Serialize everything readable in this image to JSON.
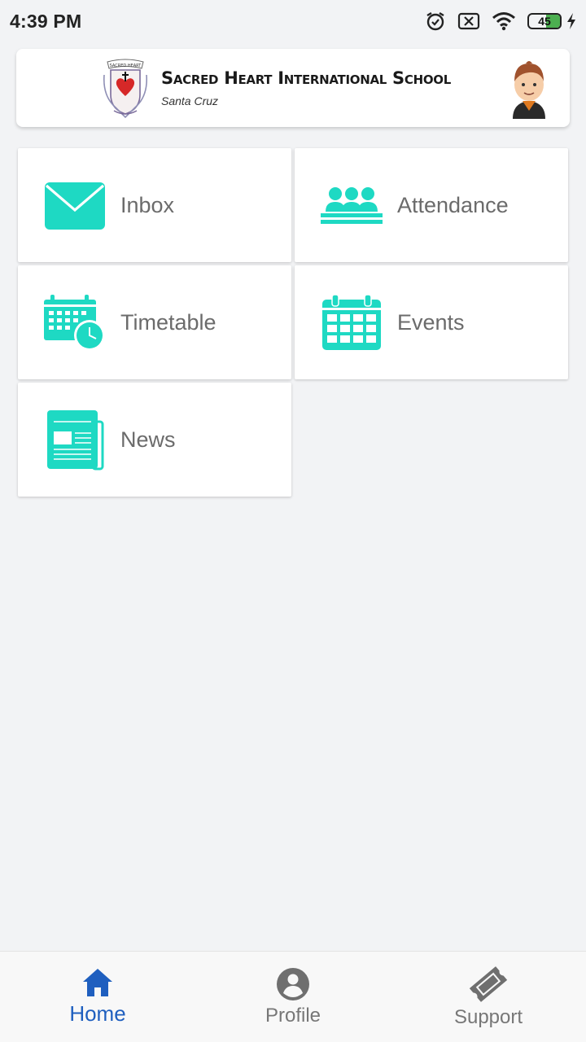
{
  "status_bar": {
    "time": "4:39 PM",
    "battery": "45"
  },
  "header": {
    "school_name": "Sacred Heart International School",
    "location": "Santa Cruz",
    "crest_text": "SACRED HEART"
  },
  "tiles": [
    {
      "label": "Inbox",
      "icon": "envelope-icon"
    },
    {
      "label": "Attendance",
      "icon": "group-icon"
    },
    {
      "label": "Timetable",
      "icon": "calendar-clock-icon"
    },
    {
      "label": "Events",
      "icon": "calendar-icon"
    },
    {
      "label": "News",
      "icon": "newspaper-icon"
    }
  ],
  "bottom_nav": {
    "items": [
      {
        "label": "Home",
        "icon": "home-icon",
        "active": true
      },
      {
        "label": "Profile",
        "icon": "person-icon",
        "active": false
      },
      {
        "label": "Support",
        "icon": "ticket-icon",
        "active": false
      }
    ]
  },
  "colors": {
    "accent": "#1ed9c3",
    "active_nav": "#1f5fbf",
    "background": "#f2f3f5"
  }
}
